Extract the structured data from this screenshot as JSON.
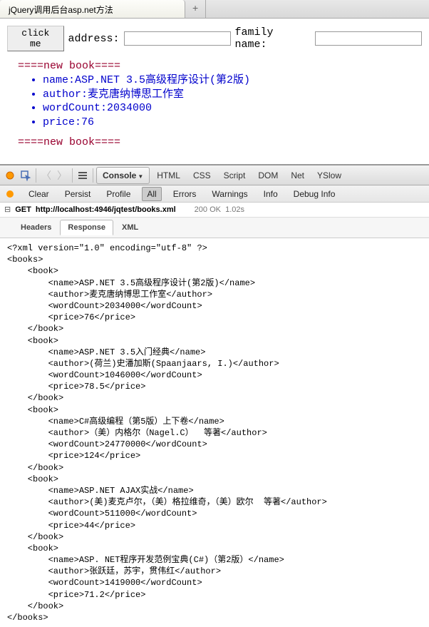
{
  "tab": {
    "title": "jQuery调用后台asp.net方法",
    "new_tab_label": "+"
  },
  "page": {
    "button_label": "click me",
    "address_label": "address:",
    "family_label": "family name:",
    "section_header": "====new book====",
    "books": [
      {
        "name": "name:ASP.NET 3.5高级程序设计(第2版)",
        "author": "author:麦克唐纳博思工作室",
        "wordcount": "wordCount:2034000",
        "price": "price:76"
      }
    ],
    "section_footer": "====new book===="
  },
  "devtools": {
    "tabs": {
      "console": "Console",
      "html": "HTML",
      "css": "CSS",
      "script": "Script",
      "dom": "DOM",
      "net": "Net",
      "yslow": "YSlow"
    },
    "subtabs": {
      "clear": "Clear",
      "persist": "Persist",
      "profile": "Profile",
      "all": "All",
      "errors": "Errors",
      "warnings": "Warnings",
      "info": "Info",
      "debug": "Debug Info"
    },
    "request": {
      "method": "GET",
      "url": "http://localhost:4946/jqtest/books.xml",
      "status": "200 OK",
      "time": "1.02s"
    },
    "resp_tabs": {
      "headers": "Headers",
      "response": "Response",
      "xml": "XML"
    },
    "xml": "<?xml version=\"1.0\" encoding=\"utf-8\" ?>\n<books>\n    <book>\n        <name>ASP.NET 3.5高级程序设计(第2版)</name>\n        <author>麦克唐纳博思工作室</author>\n        <wordCount>2034000</wordCount>\n        <price>76</price>\n    </book>\n    <book>\n        <name>ASP.NET 3.5入门经典</name>\n        <author>(荷兰)史潘加斯(Spaanjaars, I.)</author>\n        <wordCount>1046000</wordCount>\n        <price>78.5</price>\n    </book>\n    <book>\n        <name>C#高级编程（第5版）上下卷</name>\n        <author>（美）内格尔（Nagel.C）  等著</author>\n        <wordCount>24770000</wordCount>\n        <price>124</price>\n    </book>\n    <book>\n        <name>ASP.NET AJAX实战</name>\n        <author>(美)麦克卢尔，（美）格拉维奇，（美）欧尔  等著</author>\n        <wordCount>511000</wordCount>\n        <price>44</price>\n    </book>\n    <book>\n        <name>ASP. NET程序开发范例宝典(C#)（第2版）</name>\n        <author>张跃廷，苏宇，贯伟红</author>\n        <wordCount>1419000</wordCount>\n        <price>71.2</price>\n    </book>\n</books>"
  },
  "chart_data": {
    "type": "table",
    "title": "books.xml",
    "columns": [
      "name",
      "author",
      "wordCount",
      "price"
    ],
    "rows": [
      [
        "ASP.NET 3.5高级程序设计(第2版)",
        "麦克唐纳博思工作室",
        2034000,
        76
      ],
      [
        "ASP.NET 3.5入门经典",
        "(荷兰)史潘加斯(Spaanjaars, I.)",
        1046000,
        78.5
      ],
      [
        "C#高级编程（第5版）上下卷",
        "（美）内格尔（Nagel.C）  等著",
        24770000,
        124
      ],
      [
        "ASP.NET AJAX实战",
        "(美)麦克卢尔，（美）格拉维奇，（美）欧尔  等著",
        511000,
        44
      ],
      [
        "ASP. NET程序开发范例宝典(C#)（第2版）",
        "张跃廷，苏宇，贯伟红",
        1419000,
        71.2
      ]
    ]
  }
}
